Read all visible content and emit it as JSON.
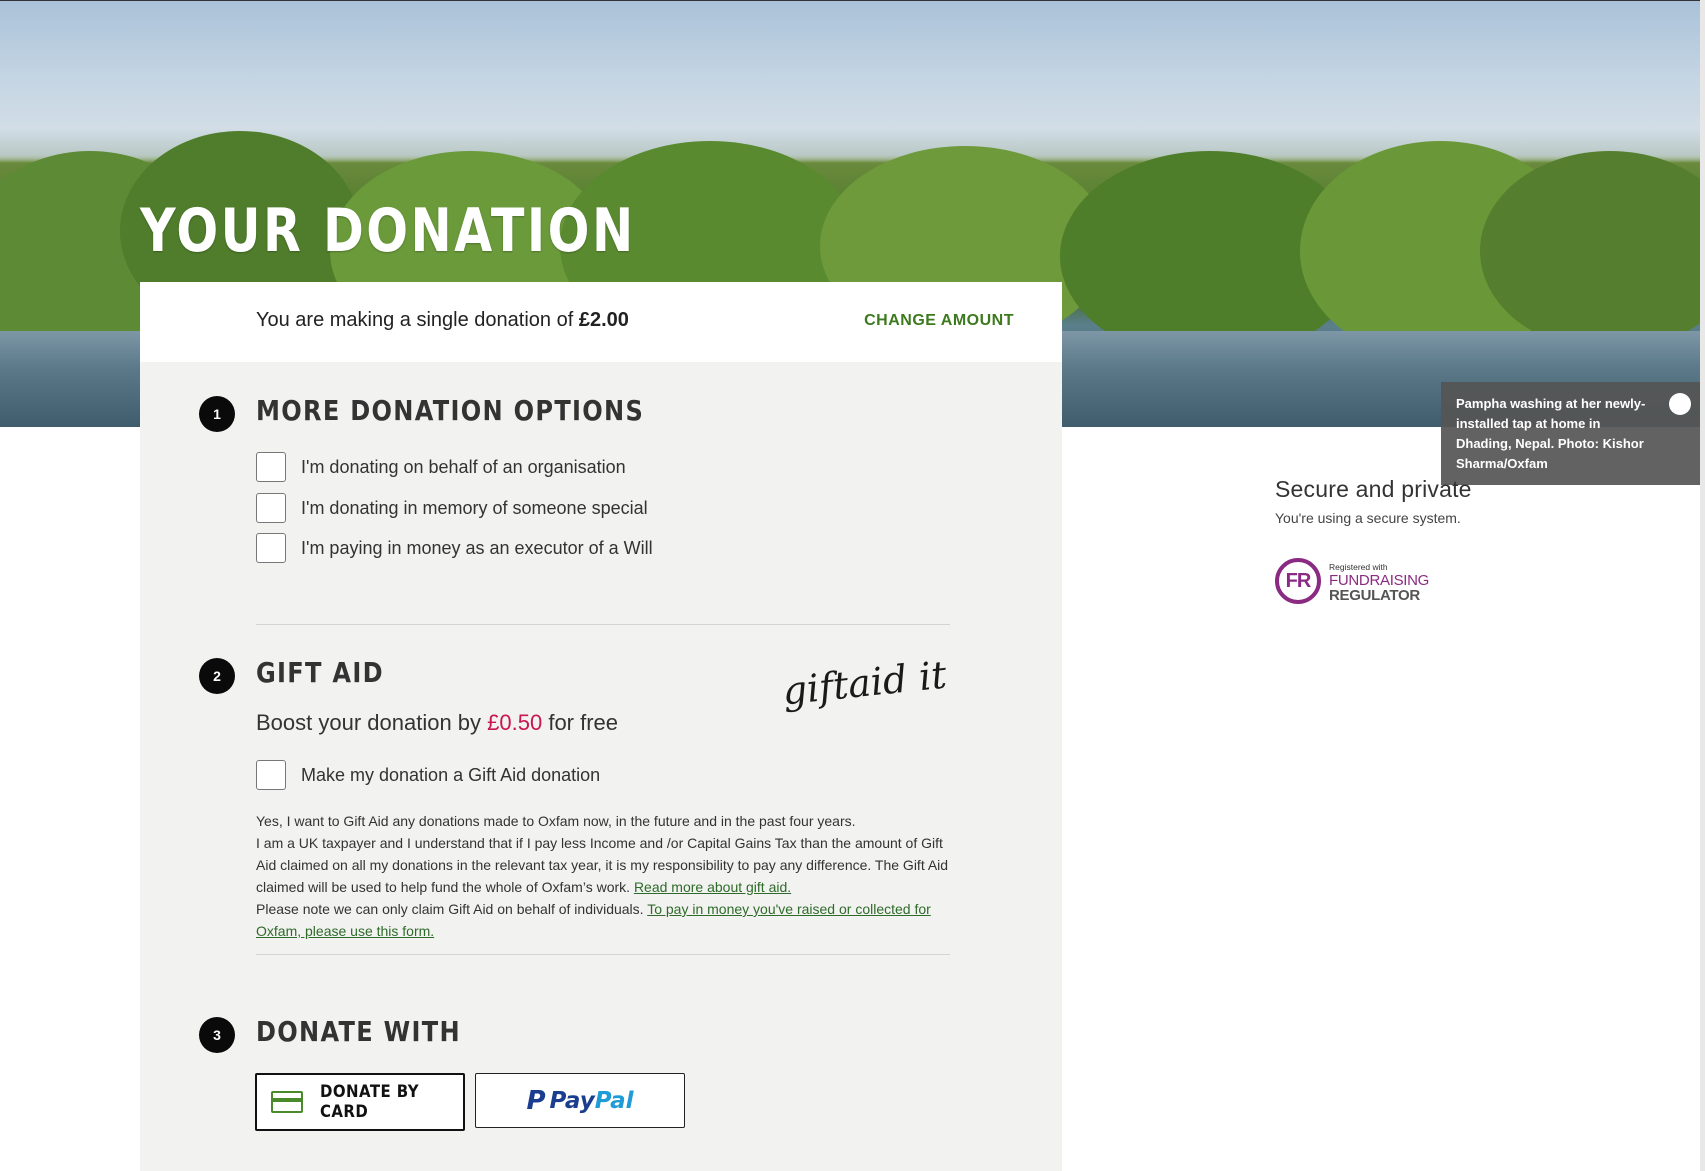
{
  "hero": {
    "title": "YOUR DONATION",
    "caption": "Pampha washing at her newly-installed tap at home in Dhading, Nepal. Photo: Kishor Sharma/Oxfam"
  },
  "summary": {
    "prefix": "You are making a single donation of ",
    "amount": "£2.00",
    "change_label": "CHANGE AMOUNT"
  },
  "sections": {
    "options": {
      "number": "1",
      "title": "MORE DONATION OPTIONS",
      "checkboxes": [
        "I'm donating on behalf of an organisation",
        "I'm donating in memory of someone special",
        "I'm paying in money as an executor of a Will"
      ]
    },
    "gift_aid": {
      "number": "2",
      "title": "GIFT AID",
      "boost_prefix": "Boost your donation by ",
      "boost_amount": "£0.50",
      "boost_suffix": " for free",
      "logo_text": "giftaid it",
      "checkbox_label": "Make my donation a Gift Aid donation",
      "legal_1": "Yes, I want to Gift Aid any donations made to Oxfam now, in the future and in the past four years.",
      "legal_2": "I am a UK taxpayer and I understand that if I pay less Income and /or Capital Gains Tax than the amount of Gift Aid claimed on all my donations in the relevant tax year, it is my responsibility to pay any difference. The Gift Aid claimed will be used to help fund the whole of Oxfam’s work. ",
      "legal_link_1": "Read more about gift aid.",
      "legal_3": "Please note we can only claim Gift Aid on behalf of individuals. ",
      "legal_link_2": "To pay in money you've raised or collected for Oxfam, please use this form."
    },
    "donate_with": {
      "number": "3",
      "title": "DONATE WITH",
      "card_label": "DONATE BY CARD",
      "paypal_label": "PayPal"
    }
  },
  "sidebar": {
    "secure_title": "Secure and private",
    "secure_text": "You're using a secure system.",
    "regulator": {
      "registered": "Registered with",
      "line1": "FUNDRAISING",
      "line2": "REGULATOR",
      "initials": "FR"
    }
  },
  "colors": {
    "accent_green": "#3d7a1e",
    "gift_pink": "#c8184f",
    "regulator_purple": "#8b2a82",
    "panel_bg": "#f2f2f0"
  }
}
